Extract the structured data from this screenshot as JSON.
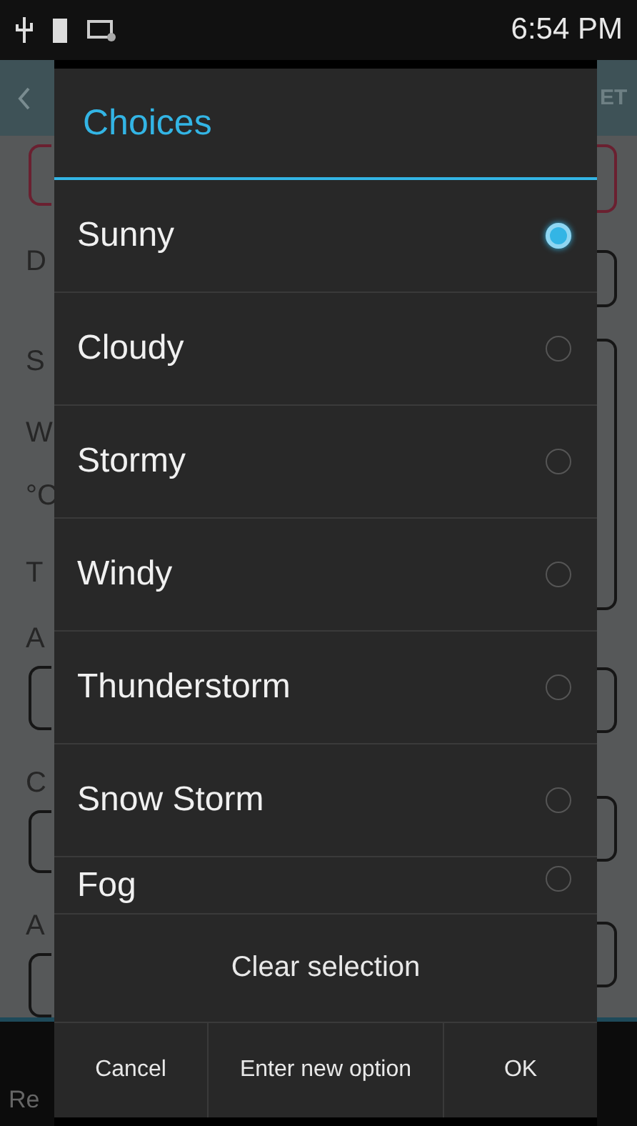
{
  "status_bar": {
    "time": "6:54 PM"
  },
  "background": {
    "app_bar_action": "ET",
    "labels": [
      "D",
      "S",
      "W",
      "°C",
      "T",
      "A",
      "C",
      "A"
    ],
    "nav_label": "Re"
  },
  "dialog": {
    "title": "Choices",
    "choices": [
      {
        "label": "Sunny",
        "selected": true
      },
      {
        "label": "Cloudy",
        "selected": false
      },
      {
        "label": "Stormy",
        "selected": false
      },
      {
        "label": "Windy",
        "selected": false
      },
      {
        "label": "Thunderstorm",
        "selected": false
      },
      {
        "label": "Snow Storm",
        "selected": false
      },
      {
        "label": "Fog",
        "selected": false
      }
    ],
    "clear_button": "Clear selection",
    "buttons": [
      "Cancel",
      "Enter new option",
      "OK"
    ]
  }
}
